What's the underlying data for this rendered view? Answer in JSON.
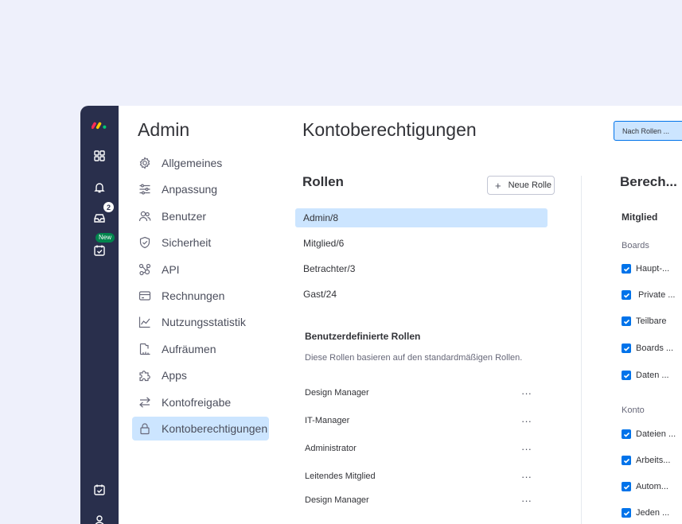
{
  "rail": {
    "inbox_count": "2",
    "new_badge": "New"
  },
  "admin": {
    "title": "Admin",
    "nav": [
      {
        "label": "Allgemeines",
        "icon": "gear-icon"
      },
      {
        "label": "Anpassung",
        "icon": "sliders-icon"
      },
      {
        "label": "Benutzer",
        "icon": "users-icon"
      },
      {
        "label": "Sicherheit",
        "icon": "shield-icon"
      },
      {
        "label": "API",
        "icon": "api-icon"
      },
      {
        "label": "Rechnungen",
        "icon": "credit-card-icon"
      },
      {
        "label": "Nutzungsstatistik",
        "icon": "chart-line-icon"
      },
      {
        "label": "Aufräumen",
        "icon": "broom-icon"
      },
      {
        "label": "Apps",
        "icon": "puzzle-icon"
      },
      {
        "label": "Kontofreigabe",
        "icon": "transfer-arrows-icon"
      },
      {
        "label": "Kontoberechtigungen",
        "icon": "lock-icon",
        "active": true
      }
    ]
  },
  "main": {
    "title": "Kontoberechtigungen",
    "sort_button": "Nach Rollen ...",
    "roles": {
      "title": "Rollen",
      "new_role_button": "Neue Rolle",
      "items": [
        "Admin/8",
        "Mitglied/6",
        "Betrachter/3",
        "Gast/24"
      ]
    },
    "custom": {
      "title": "Benutzerdefinierte Rollen",
      "description": "Diese Rollen basieren auf den standardmäßigen Rollen.",
      "items": [
        "Design Manager",
        "IT-Manager",
        "Administrator",
        "Leitendes Mitglied",
        "Design Manager"
      ],
      "more": "···"
    },
    "permissions": {
      "title": "Berech...",
      "role": "Mitglied",
      "boards_label": "Boards",
      "boards": [
        "Haupt-...",
        "Private ...",
        "Teilbare",
        "Boards ...",
        "Daten ..."
      ],
      "konto_label": "Konto",
      "konto": [
        "Dateien ...",
        "Arbeits...",
        "Autom...",
        "Jeden ..."
      ]
    }
  },
  "colors": {
    "rail": "#292f4c",
    "accent": "#0073ea",
    "active_bg": "#cce5ff",
    "page_bg": "#eef0fb"
  }
}
